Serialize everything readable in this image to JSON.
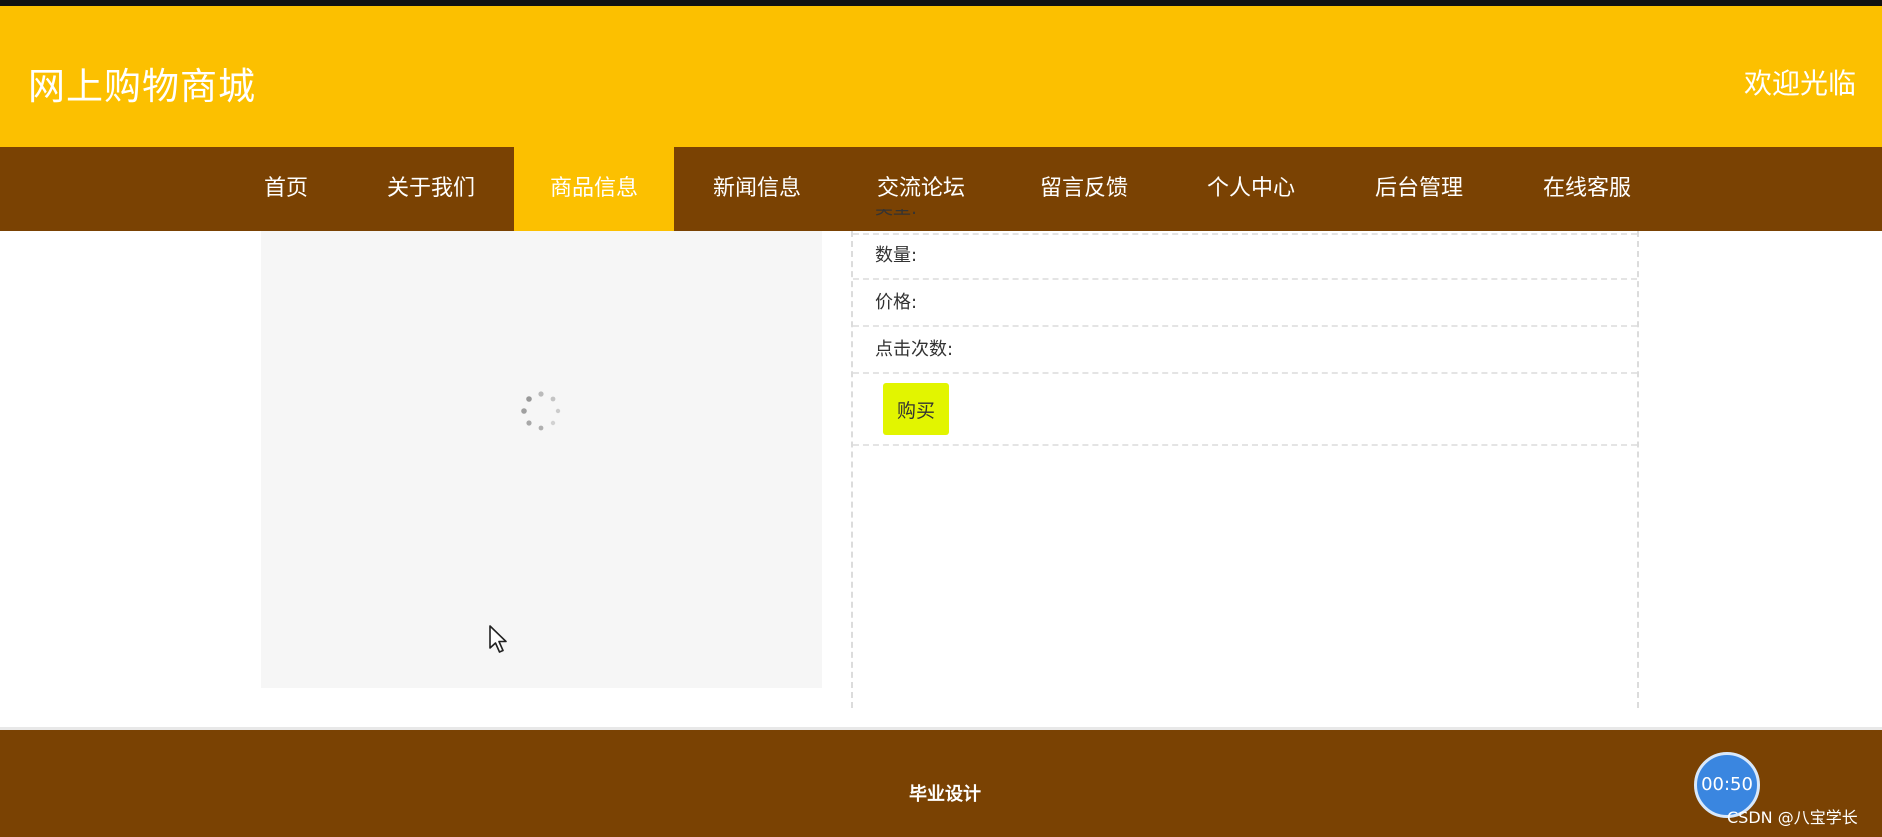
{
  "header": {
    "site_title": "网上购物商城",
    "welcome": "欢迎光临",
    "accent_color": "#fcc000"
  },
  "nav": {
    "items": [
      {
        "label": "首页"
      },
      {
        "label": "关于我们"
      },
      {
        "label": "商品信息",
        "active": true
      },
      {
        "label": "新闻信息"
      },
      {
        "label": "交流论坛"
      },
      {
        "label": "留言反馈"
      },
      {
        "label": "个人中心"
      },
      {
        "label": "后台管理"
      },
      {
        "label": "在线客服"
      }
    ],
    "background_color": "#7a4203"
  },
  "product": {
    "image_state": "loading",
    "fields": [
      {
        "label": "数量:"
      },
      {
        "label": "价格:"
      },
      {
        "label": "点击次数:"
      }
    ],
    "buy_label": "购买",
    "buy_color": "#e2f500"
  },
  "footer": {
    "text": "毕业设计"
  },
  "overlay": {
    "timer": "00:50",
    "watermark": "CSDN @八宝学长"
  }
}
